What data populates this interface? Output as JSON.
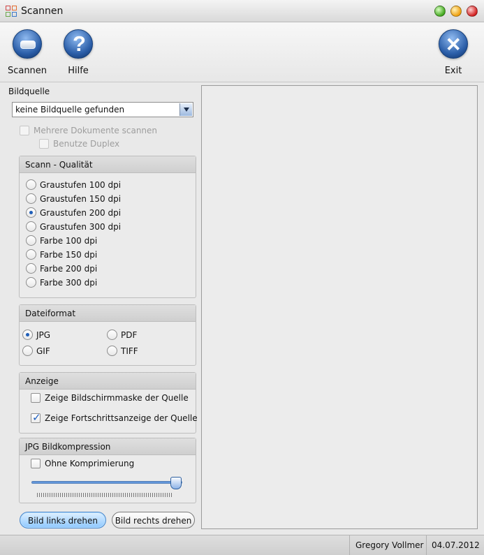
{
  "window": {
    "title": "Scannen"
  },
  "toolbar": {
    "scan_label": "Scannen",
    "help_label": "Hilfe",
    "exit_label": "Exit"
  },
  "left": {
    "source_label": "Bildquelle",
    "source_value": "keine Bildquelle gefunden",
    "multi_docs": "Mehrere Dokumente scannen",
    "duplex": "Benutze Duplex",
    "quality_title": "Scann - Qualität",
    "quality_options": [
      "Graustufen 100 dpi",
      "Graustufen 150 dpi",
      "Graustufen 200 dpi",
      "Graustufen 300 dpi",
      "Farbe 100 dpi",
      "Farbe 150 dpi",
      "Farbe 200 dpi",
      "Farbe 300 dpi"
    ],
    "format_title": "Dateiformat",
    "formats": [
      "JPG",
      "PDF",
      "GIF",
      "TIFF"
    ],
    "display_title": "Anzeige",
    "display_mask": "Zeige Bildschirmmaske der Quelle",
    "display_progress": "Zeige Fortschrittsanzeige der Quelle",
    "jpg_title": "JPG Bildkompression",
    "no_compress": "Ohne Komprimierung",
    "slider_level": 0.93,
    "rotate_left": "Bild links drehen",
    "rotate_right": "Bild rechts drehen"
  },
  "status": {
    "user": "Gregory Vollmer",
    "date": "04.07.2012"
  }
}
